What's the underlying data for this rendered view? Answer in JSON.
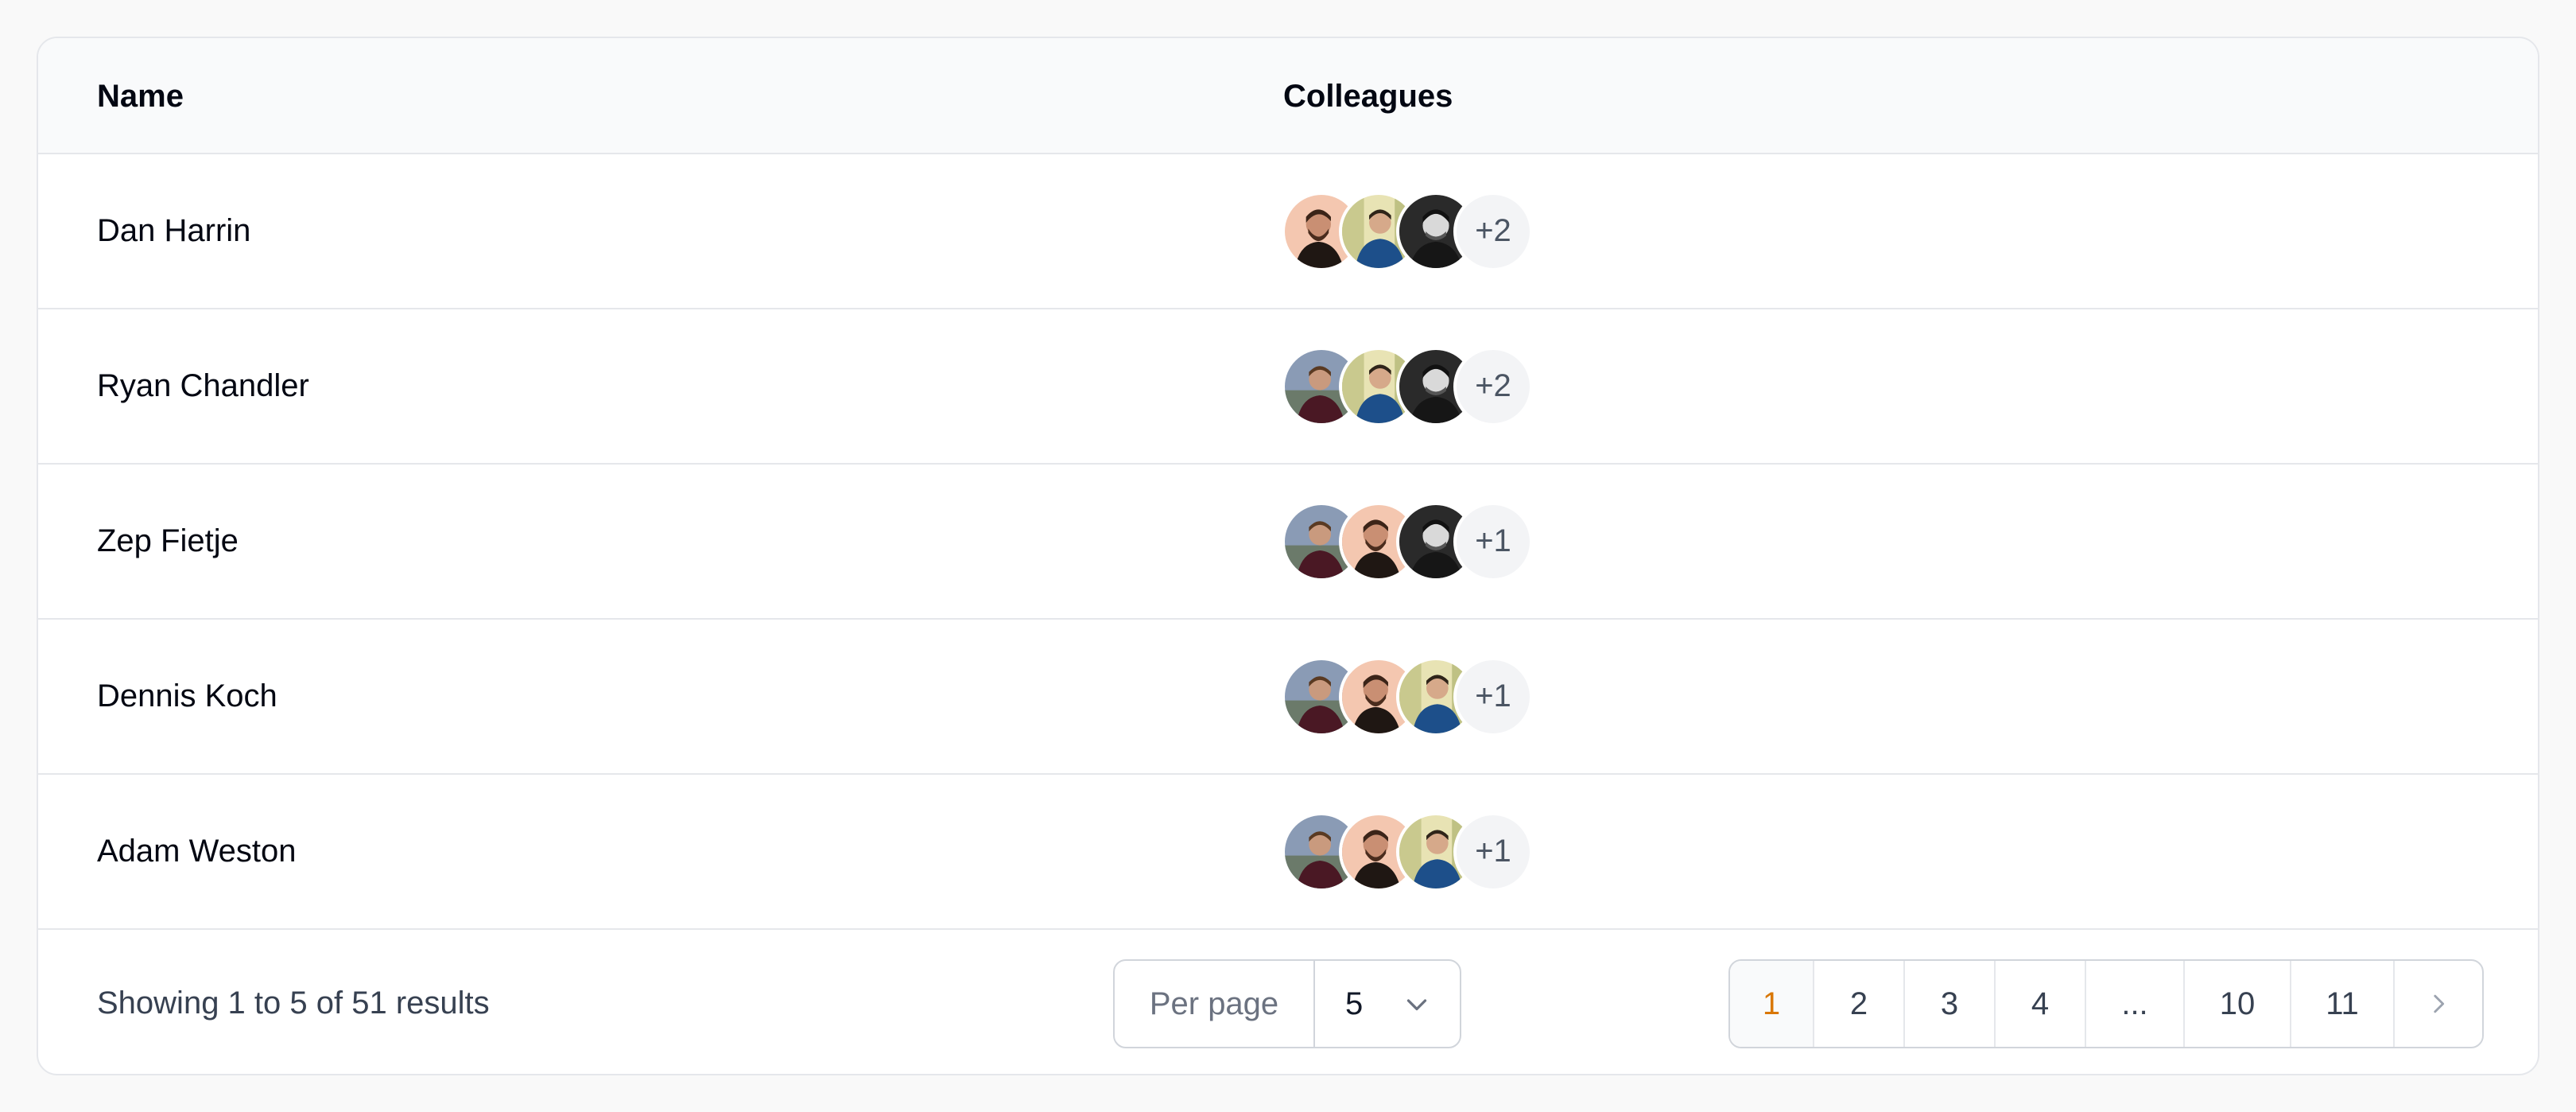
{
  "table": {
    "headers": {
      "name": "Name",
      "colleagues": "Colleagues"
    },
    "rows": [
      {
        "name": "Dan Harrin",
        "avatars": [
          "beard-man-peach",
          "man-blue-sweater",
          "man-bw"
        ],
        "more": "+2"
      },
      {
        "name": "Ryan Chandler",
        "avatars": [
          "man-maroon-outdoor",
          "man-blue-sweater",
          "man-bw"
        ],
        "more": "+2"
      },
      {
        "name": "Zep Fietje",
        "avatars": [
          "man-maroon-outdoor",
          "beard-man-peach",
          "man-bw"
        ],
        "more": "+1"
      },
      {
        "name": "Dennis Koch",
        "avatars": [
          "man-maroon-outdoor",
          "beard-man-peach",
          "man-blue-sweater"
        ],
        "more": "+1"
      },
      {
        "name": "Adam Weston",
        "avatars": [
          "man-maroon-outdoor",
          "beard-man-peach",
          "man-blue-sweater"
        ],
        "more": "+1"
      }
    ]
  },
  "footer": {
    "showing": "Showing 1 to 5 of 51 results",
    "per_page_label": "Per page",
    "per_page_value": "5",
    "pages": [
      "1",
      "2",
      "3",
      "4",
      "...",
      "10",
      "11"
    ],
    "active_page": "1",
    "next_icon": "chevron-right-icon",
    "select_icon": "chevron-down-icon"
  },
  "colors": {
    "accent": "#d97706",
    "border": "#e5e7eb",
    "header_bg": "#f9fafb"
  }
}
